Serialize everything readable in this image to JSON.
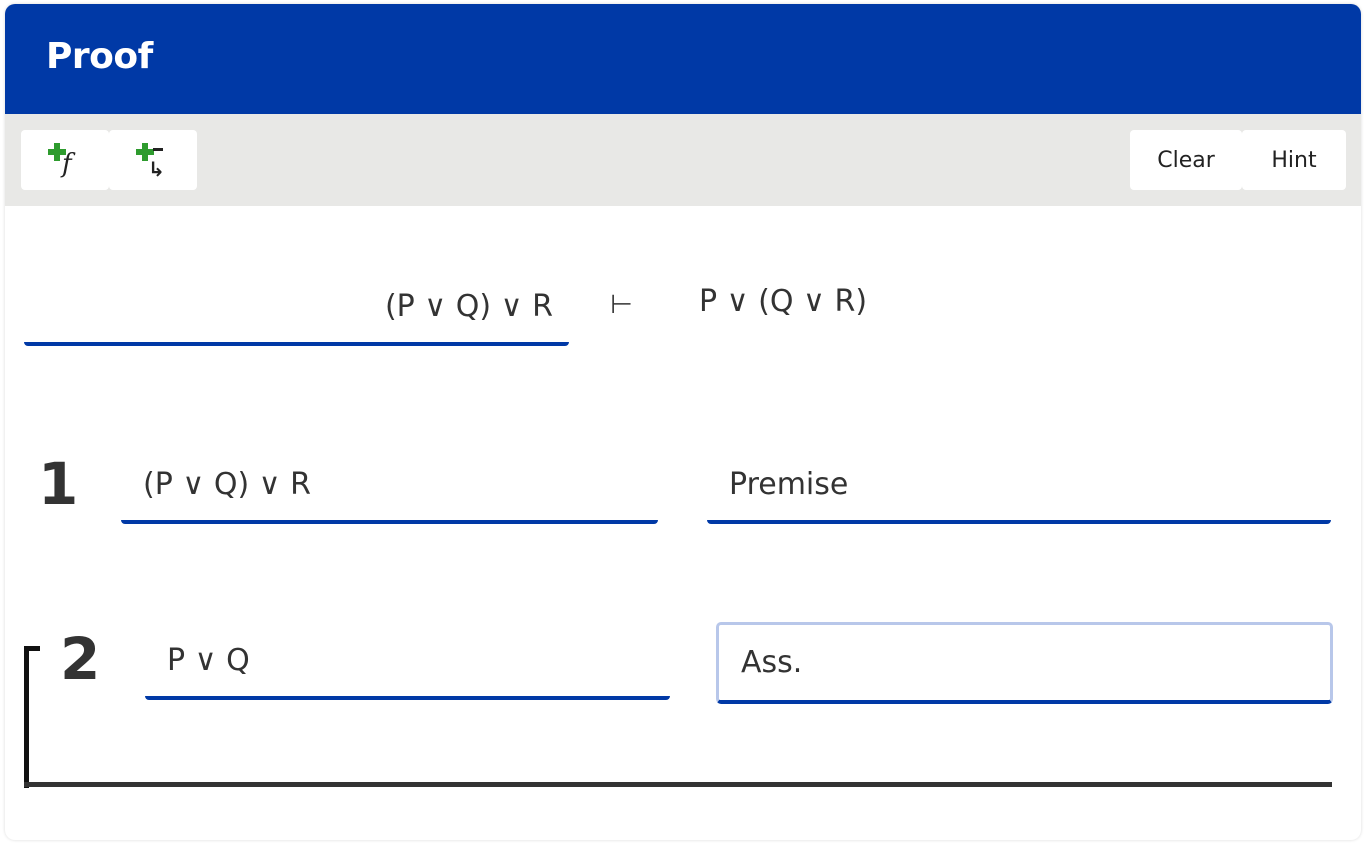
{
  "header": {
    "title": "Proof"
  },
  "colors": {
    "header_bg": "#0039a6",
    "toolbar_bg": "#e8e8e6",
    "accent": "#0039a6",
    "plus_green": "#2e9b2e"
  },
  "toolbar": {
    "add_line_icon": "add-formula-icon",
    "add_subproof_icon": "add-subproof-icon",
    "clear_label": "Clear",
    "hint_label": "Hint"
  },
  "problem": {
    "premises": "(P ∨ Q) ∨ R",
    "turnstile": "⊢",
    "conclusion": "P ∨ (Q ∨ R)"
  },
  "lines": [
    {
      "number": "1",
      "formula": "(P ∨ Q) ∨ R",
      "justification": "Premise"
    },
    {
      "number": "2",
      "formula": "P ∨ Q",
      "justification": "Ass."
    }
  ]
}
